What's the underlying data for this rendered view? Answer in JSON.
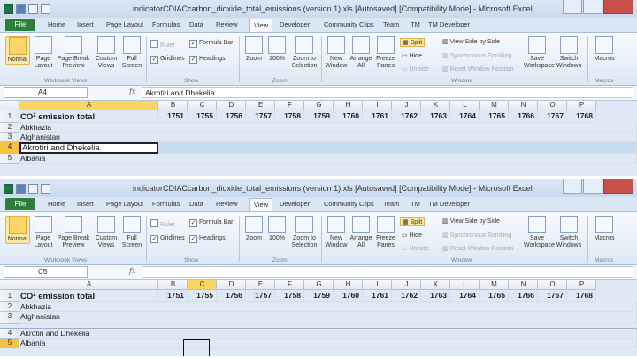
{
  "windows": [
    {
      "title": "indicatorCDIACcarbon_dioxide_total_emissions (version 1).xls [Autosaved]  [Compatibility Mode]  -  Microsoft Excel",
      "tabs": {
        "file": "File",
        "home": "Home",
        "insert": "Insert",
        "page_layout": "Page Layout",
        "formulas": "Formulas",
        "data": "Data",
        "review": "Review",
        "view": "View",
        "developer": "Developer",
        "community_clips": "Community Clips",
        "team": "Team",
        "tm": "TM",
        "tm_developer": "TM Developer"
      },
      "ribbon": {
        "normal": "Normal",
        "page_layout": "Page Layout",
        "page_break": "Page Break Preview",
        "custom_views": "Custom Views",
        "full_screen": "Full Screen",
        "ruler": "Ruler",
        "gridlines": "Gridlines",
        "formula_bar": "Formula Bar",
        "headings": "Headings",
        "zoom": "Zoom",
        "zoom100": "100%",
        "zoom_selection": "Zoom to Selection",
        "new_window": "New Window",
        "arrange_all": "Arrange All",
        "freeze_panes": "Freeze Panes",
        "split": "Split",
        "hide": "Hide",
        "unhide": "Unhide",
        "side_by_side": "View Side by Side",
        "sync_scroll": "Synchronous Scrolling",
        "reset_pos": "Reset Window Position",
        "save_workspace": "Save Workspace",
        "switch_windows": "Switch Windows",
        "macros": "Macros",
        "grp_workbook_views": "Workbook Views",
        "grp_show": "Show",
        "grp_zoom": "Zoom",
        "grp_window": "Window",
        "grp_macros": "Macros"
      },
      "name_box": "A4",
      "formula": "Akrotiri and Dhekelia",
      "columns": [
        "A",
        "B",
        "C",
        "D",
        "E",
        "F",
        "G",
        "H",
        "I",
        "J",
        "K",
        "L",
        "M",
        "N",
        "O",
        "P"
      ],
      "header_row": {
        "label": "CO",
        "sup": "2",
        "rest": " emission total",
        "years": [
          "1751",
          "1755",
          "1756",
          "1757",
          "1758",
          "1759",
          "1760",
          "1761",
          "1762",
          "1763",
          "1764",
          "1765",
          "1766",
          "1767",
          "1768"
        ]
      },
      "rows": [
        {
          "n": "2",
          "a": "Abkhazia"
        },
        {
          "n": "3",
          "a": "Afghanistan"
        },
        {
          "n": "4",
          "a": "Akrotiri and Dhekelia"
        },
        {
          "n": "5",
          "a": "Albania"
        }
      ]
    },
    {
      "title": "indicatorCDIACcarbon_dioxide_total_emissions (version 1).xls [Autosaved]  [Compatibility Mode]  -  Microsoft Excel",
      "name_box": "C5",
      "formula": "",
      "header_row": {
        "label": "CO",
        "sup": "2",
        "rest": " emission total",
        "years": [
          "1751",
          "1755",
          "1756",
          "1757",
          "1758",
          "1759",
          "1760",
          "1761",
          "1762",
          "1763",
          "1764",
          "1765",
          "1766",
          "1767",
          "1768"
        ]
      },
      "rows": [
        {
          "n": "2",
          "a": "Abkhazia"
        },
        {
          "n": "3",
          "a": "Afghanistan"
        },
        {
          "n": "4",
          "a": "Akrotiri and Dhekelia"
        },
        {
          "n": "5",
          "a": "Albania"
        }
      ]
    }
  ]
}
